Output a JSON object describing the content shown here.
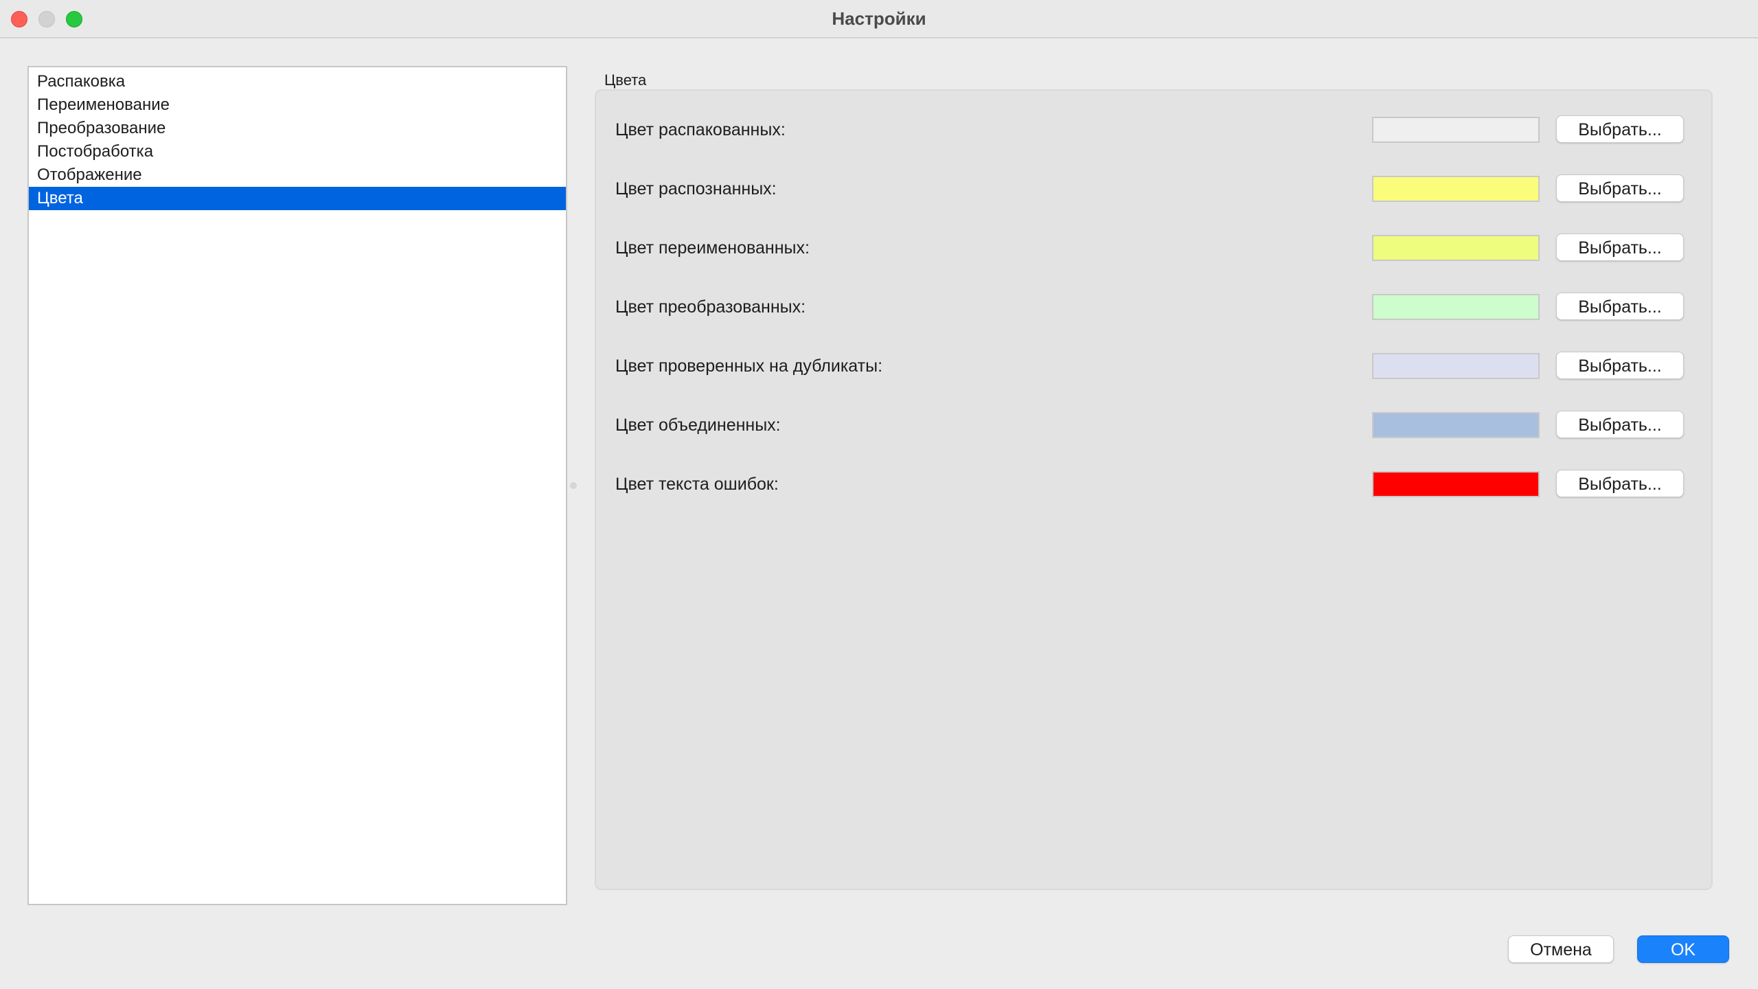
{
  "window": {
    "title": "Настройки"
  },
  "sidebar": {
    "items": [
      {
        "label": "Распаковка",
        "selected": false
      },
      {
        "label": "Переименование",
        "selected": false
      },
      {
        "label": "Преобразование",
        "selected": false
      },
      {
        "label": "Постобработка",
        "selected": false
      },
      {
        "label": "Отображение",
        "selected": false
      },
      {
        "label": "Цвета",
        "selected": true
      }
    ]
  },
  "colors_group": {
    "title": "Цвета",
    "rows": [
      {
        "label": "Цвет распакованных:",
        "color": "#efefef",
        "button_label": "Выбрать..."
      },
      {
        "label": "Цвет распознанных:",
        "color": "#fafd7c",
        "button_label": "Выбрать..."
      },
      {
        "label": "Цвет переименованных:",
        "color": "#eefd7e",
        "button_label": "Выбрать..."
      },
      {
        "label": "Цвет преобразованных:",
        "color": "#cdfccd",
        "button_label": "Выбрать..."
      },
      {
        "label": "Цвет проверенных на дубликаты:",
        "color": "#dcdff0",
        "button_label": "Выбрать..."
      },
      {
        "label": "Цвет объединенных:",
        "color": "#a8bfe0",
        "button_label": "Выбрать..."
      },
      {
        "label": "Цвет текста ошибок:",
        "color": "#ff0000",
        "button_label": "Выбрать..."
      }
    ]
  },
  "footer": {
    "cancel_label": "Отмена",
    "ok_label": "OK"
  }
}
